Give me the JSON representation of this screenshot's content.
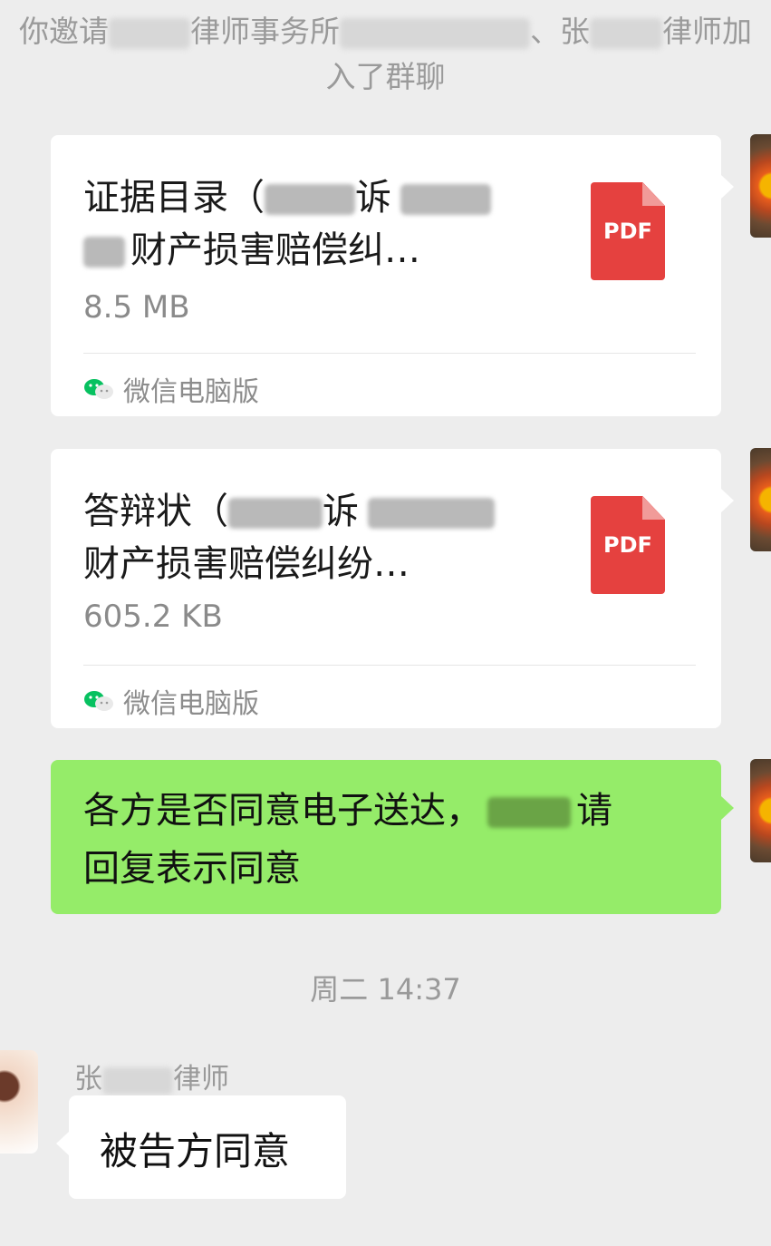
{
  "system_message": {
    "line1_parts": [
      "你邀请",
      "律师事务所",
      "、张",
      "律师加"
    ],
    "line2": "入了群聊"
  },
  "files": [
    {
      "title_line1_parts": [
        "证据目录（",
        "诉"
      ],
      "title_line2": "财产损害赔偿纠…",
      "size": "8.5 MB",
      "icon_label": "PDF",
      "source": "微信电脑版"
    },
    {
      "title_line1_parts": [
        "答辩状（",
        "诉"
      ],
      "title_line2": "财产损害赔偿纠纷…",
      "size": "605.2 KB",
      "icon_label": "PDF",
      "source": "微信电脑版"
    }
  ],
  "outgoing_message": {
    "line1_parts": [
      "各方是否同意电子送达，",
      "请"
    ],
    "line2": "回复表示同意"
  },
  "timestamp": "周二 14:37",
  "incoming": {
    "sender_parts": [
      "张",
      "律师"
    ],
    "text": "被告方同意"
  },
  "colors": {
    "background": "#ededed",
    "outgoing_bubble": "#95ec69",
    "incoming_bubble": "#ffffff",
    "pdf_icon": "#e5413f",
    "wechat_green": "#07c160"
  }
}
